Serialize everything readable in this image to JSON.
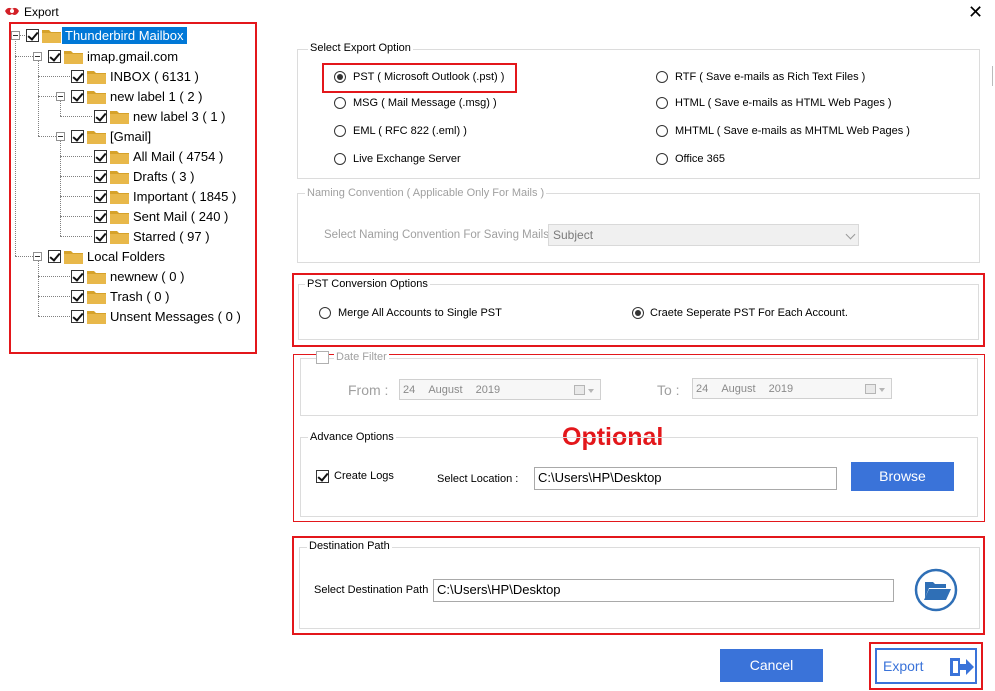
{
  "window": {
    "title": "Export",
    "close_glyph": "✕"
  },
  "tree": {
    "root": "Thunderbird Mailbox",
    "account": "imap.gmail.com",
    "inbox": "INBOX ( 6131 )",
    "new_label_1": "new label 1 ( 2 )",
    "new_label_3": "new label 3 ( 1 )",
    "gmail": "[Gmail]",
    "all_mail": "All Mail ( 4754 )",
    "drafts": "Drafts ( 3 )",
    "important": "Important ( 1845 )",
    "sent_mail": "Sent Mail ( 240 )",
    "starred": "Starred ( 97 )",
    "local_folders": "Local Folders",
    "newnew": "newnew ( 0 )",
    "trash": "Trash ( 0 )",
    "unsent": "Unsent Messages ( 0 )"
  },
  "export_options": {
    "title": "Select Export Option",
    "pst": "PST ( Microsoft Outlook (.pst) )",
    "msg": "MSG ( Mail Message (.msg) )",
    "eml": "EML ( RFC 822 (.eml) )",
    "live": "Live Exchange Server",
    "rtf": "RTF ( Save e-mails as Rich Text Files )",
    "html": "HTML ( Save e-mails as HTML Web Pages )",
    "mhtml": "MHTML ( Save e-mails as MHTML Web Pages )",
    "office365": "Office 365",
    "selected": "pst"
  },
  "naming": {
    "title": "Naming Convention ( Applicable Only For Mails )",
    "label": "Select Naming Convention For Saving Mails",
    "value": "Subject"
  },
  "pst_conversion": {
    "title": "PST Conversion Options",
    "merge": "Merge All Accounts to Single PST",
    "separate": "Craete Seperate PST For Each Account.",
    "selected": "separate"
  },
  "date_filter": {
    "title": "Date Filter",
    "from_label": "From :",
    "from_day": "24",
    "from_month": "August",
    "from_year": "2019",
    "to_label": "To :",
    "to_day": "24",
    "to_month": "August",
    "to_year": "2019"
  },
  "optional_label": "Optional",
  "advance": {
    "title": "Advance Options",
    "create_logs": "Create Logs",
    "location_label": "Select Location :",
    "location_value": "C:\\Users\\HP\\Desktop",
    "browse": "Browse"
  },
  "destination": {
    "title": "Destination Path",
    "label": "Select Destination Path",
    "value": "C:\\Users\\HP\\Desktop",
    "icon": "open-folder-icon"
  },
  "buttons": {
    "cancel": "Cancel",
    "export": "Export"
  },
  "colors": {
    "highlight": "#e3171b",
    "accent": "#3a73d9",
    "selection": "#0078d7"
  }
}
